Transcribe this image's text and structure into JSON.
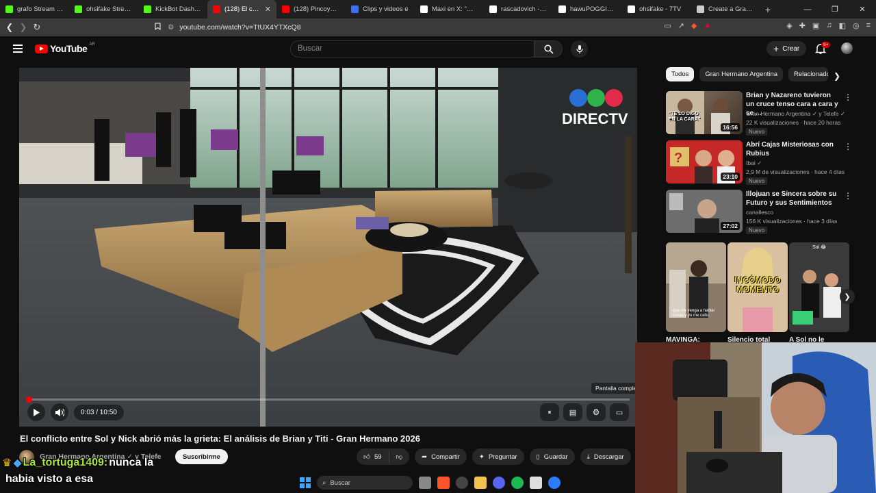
{
  "browser": {
    "tabs": [
      {
        "label": "grafo Stream - V",
        "icon": "kick-icon",
        "color": "#53fc18",
        "active": false
      },
      {
        "label": "ohsifake Stream",
        "icon": "kick-icon",
        "color": "#53fc18",
        "active": false
      },
      {
        "label": "KickBot Dashboard",
        "icon": "kickbot-icon",
        "color": "#53fc18",
        "active": false
      },
      {
        "label": "(128) El confl",
        "icon": "youtube-icon",
        "color": "#ff0000",
        "active": true
      },
      {
        "label": "(128) Pincoya habla",
        "icon": "youtube-icon",
        "color": "#ff0000",
        "active": false
      },
      {
        "label": "Clips y videos e",
        "icon": "clips-icon",
        "color": "#3d6dff",
        "active": false
      },
      {
        "label": "Maxi en X: \"@clipsy",
        "icon": "x-icon",
        "color": "#ffffff",
        "active": false
      },
      {
        "label": "rascadovich - 7TV",
        "icon": "7tv-icon",
        "color": "#ffffff",
        "active": false
      },
      {
        "label": "hawuPOGGIES - 7T",
        "icon": "7tv-icon",
        "color": "#ffffff",
        "active": false
      },
      {
        "label": "ohsifake - 7TV",
        "icon": "7tv-icon",
        "color": "#ffffff",
        "active": false
      },
      {
        "label": "Create a Gran herm",
        "icon": "doc-icon",
        "color": "#cccccc",
        "active": false
      }
    ],
    "url": "youtube.com/watch?v=TtUX4YTXcQ8"
  },
  "youtube": {
    "region": "AR",
    "logo_text": "YouTube",
    "search_placeholder": "Buscar",
    "create_label": "Crear",
    "notif_badge": "9+"
  },
  "player": {
    "time": "0:03 / 10:50",
    "progress": 0.003,
    "tooltip": "Pantalla comple",
    "watermark": "DIRECTV"
  },
  "video": {
    "title": "El conflicto entre Sol y Nick abrió más la grieta: El análisis de Brian y Titi - Gran Hermano 2026",
    "channel": "Gran Hermano Argentina",
    "channel_suffix": "y Telefe",
    "subscribe": "Suscribirme",
    "likes": "59",
    "actions": {
      "share": "Compartir",
      "ask": "Preguntar",
      "save": "Guardar",
      "download": "Descargar"
    }
  },
  "chips": [
    "Todos",
    "Gran Hermano Argentina",
    "Relacionado"
  ],
  "recommendations": [
    {
      "title": "Brian y Nazareno tuvieron un cruce tenso cara a cara y se ...",
      "channel": "Gran Hermano Argentina",
      "channel2": "y Telefe",
      "meta": "22 K visualizaciones · hace 20 horas",
      "badge": "Nuevo",
      "duration": "16:56",
      "thumb_text": "\"TE LO DIGO EN LA CARA\""
    },
    {
      "title": "Abrí Cajas Misteriosas con Rubius",
      "channel": "Ibai",
      "channel2": "",
      "meta": "2,9 M de visualizaciones · hace 4 días",
      "badge": "Nuevo",
      "duration": "23:10",
      "thumb_text": ""
    },
    {
      "title": "Illojuan se Sincera sobre su Futuro y sus Sentimientos",
      "channel": "canallesco",
      "channel2": "",
      "meta": "156 K visualizaciones · hace 3 días",
      "badge": "Nuevo",
      "duration": "27:02",
      "thumb_text": ""
    }
  ],
  "shorts": [
    {
      "title": "MAVINGA:",
      "caption": "que me venga a hablar cosas y yo me callo."
    },
    {
      "title": "Silencio total",
      "caption": "INCÓMODO MOMENTO"
    },
    {
      "title": "A Sol no le",
      "caption": "Sol 😂"
    }
  ],
  "chat": {
    "user": "La_tortuga1409:",
    "line1": "nunca la",
    "line2": "habia visto a esa"
  },
  "taskbar": {
    "search": "Buscar"
  }
}
